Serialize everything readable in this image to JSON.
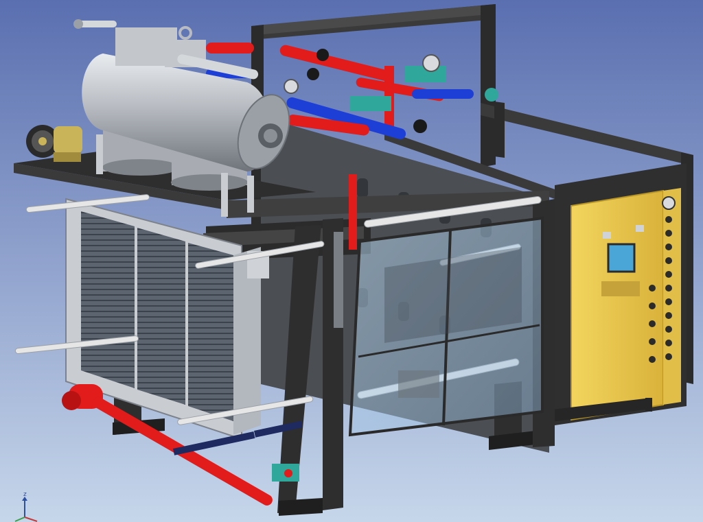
{
  "viewport": {
    "background_top": "#5a6fb0",
    "background_bottom": "#c6d6ea"
  },
  "model": {
    "frame_color": "#3a3a3a",
    "frame_dark": "#262626",
    "tank_color": "#b8bcc2",
    "pipe_red": "#e21b1b",
    "pipe_blue": "#1e3fd6",
    "pipe_teal": "#2fa79a",
    "cabinet_color": "#e9c84b",
    "cabinet_edge": "#b89524",
    "hmi_screen": "#4aa6d6",
    "glass_tint": "#9fc8e6",
    "rod_color": "#e6e6e6",
    "plate_color": "#c9cdd2",
    "grille_color": "#5c6470"
  },
  "triad": {
    "axis_label": "z",
    "icon": "coordinate-triad-icon"
  }
}
